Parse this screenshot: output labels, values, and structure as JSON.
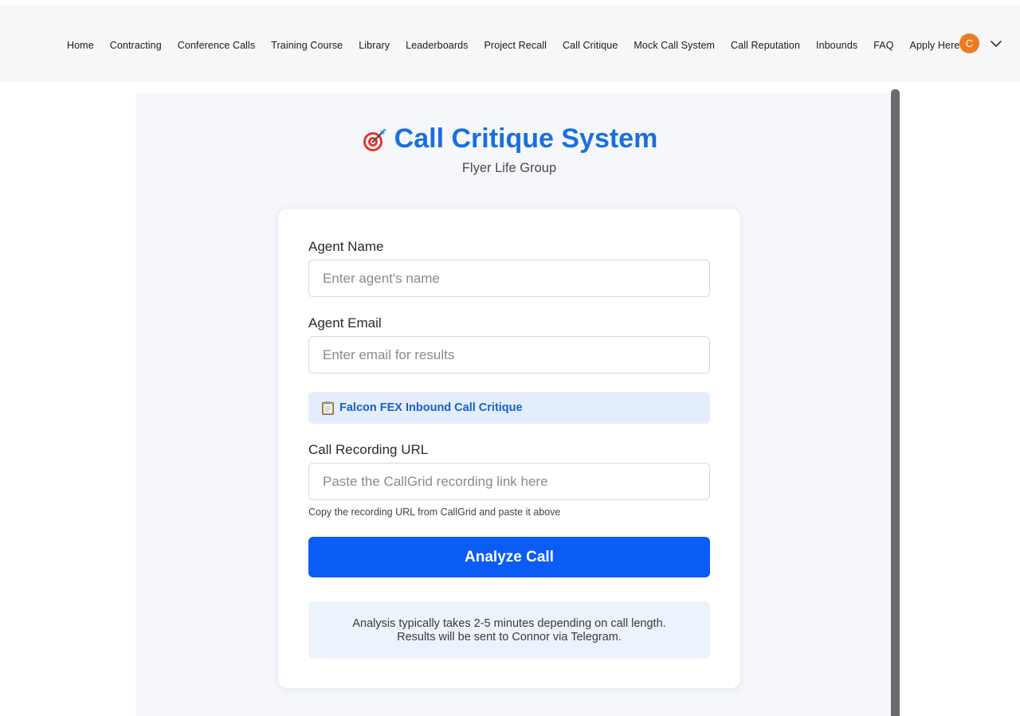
{
  "nav": {
    "items": [
      "Home",
      "Contracting",
      "Conference Calls",
      "Training Course",
      "Library",
      "Leaderboards",
      "Project Recall",
      "Call Critique",
      "Mock Call System",
      "Call Reputation",
      "Inbounds",
      "FAQ",
      "Apply Here"
    ],
    "avatar_initial": "C"
  },
  "header": {
    "icon": "dart-target-icon",
    "title": "Call Critique System",
    "subtitle": "Flyer Life Group"
  },
  "form": {
    "agent_name": {
      "label": "Agent Name",
      "placeholder": "Enter agent's name",
      "value": ""
    },
    "agent_email": {
      "label": "Agent Email",
      "placeholder": "Enter email for results",
      "value": ""
    },
    "critique_type": {
      "icon": "clipboard-icon",
      "label": "Falcon FEX Inbound Call Critique"
    },
    "recording_url": {
      "label": "Call Recording URL",
      "placeholder": "Paste the CallGrid recording link here",
      "value": "",
      "help": "Copy the recording URL from CallGrid and paste it above"
    },
    "submit_label": "Analyze Call",
    "note_line1": "Analysis typically takes 2-5 minutes depending on call length.",
    "note_line2": "Results will be sent to Connor via Telegram."
  },
  "colors": {
    "accent": "#1a6fe0",
    "button": "#0b5cf5",
    "avatar": "#f07a22"
  }
}
